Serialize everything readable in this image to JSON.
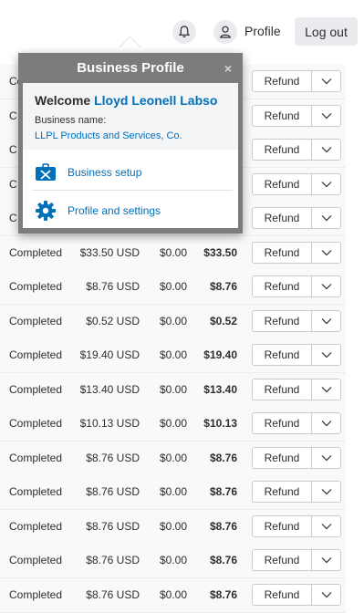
{
  "header": {
    "profile_label": "Profile",
    "logout_label": "Log out",
    "bell_icon": "bell-icon",
    "profile_icon": "user-icon"
  },
  "popup": {
    "title": "Business Profile",
    "close_glyph": "×",
    "welcome_prefix": "Welcome",
    "user_name": "Lloyd Leonell Labso",
    "business_name_label": "Business name:",
    "business_name": "LLPL Products and Services, Co.",
    "menu": [
      {
        "label": "Business setup",
        "icon": "business-setup-icon"
      },
      {
        "label": "Profile and settings",
        "icon": "gear-icon"
      }
    ]
  },
  "table": {
    "refund_label": "Refund",
    "hidden_rows": [
      {
        "status": "Completed"
      },
      {
        "status": "C"
      },
      {
        "status": "C"
      },
      {
        "status": "C"
      },
      {
        "status": "C"
      }
    ],
    "rows": [
      {
        "status": "Completed",
        "amount": "$33.50 USD",
        "fee": "$0.00",
        "net": "$33.50"
      },
      {
        "status": "Completed",
        "amount": "$8.76 USD",
        "fee": "$0.00",
        "net": "$8.76"
      },
      {
        "status": "Completed",
        "amount": "$0.52 USD",
        "fee": "$0.00",
        "net": "$0.52"
      },
      {
        "status": "Completed",
        "amount": "$19.40 USD",
        "fee": "$0.00",
        "net": "$19.40"
      },
      {
        "status": "Completed",
        "amount": "$13.40 USD",
        "fee": "$0.00",
        "net": "$13.40"
      },
      {
        "status": "Completed",
        "amount": "$10.13 USD",
        "fee": "$0.00",
        "net": "$10.13"
      },
      {
        "status": "Completed",
        "amount": "$8.76 USD",
        "fee": "$0.00",
        "net": "$8.76"
      },
      {
        "status": "Completed",
        "amount": "$8.76 USD",
        "fee": "$0.00",
        "net": "$8.76"
      },
      {
        "status": "Completed",
        "amount": "$8.76 USD",
        "fee": "$0.00",
        "net": "$8.76"
      },
      {
        "status": "Completed",
        "amount": "$8.76 USD",
        "fee": "$0.00",
        "net": "$8.76"
      },
      {
        "status": "Completed",
        "amount": "$8.76 USD",
        "fee": "$0.00",
        "net": "$8.76"
      }
    ]
  },
  "colors": {
    "link_blue": "#0070ba",
    "popup_header_gray": "#7c7c7c",
    "button_gray": "#e9ebee"
  }
}
